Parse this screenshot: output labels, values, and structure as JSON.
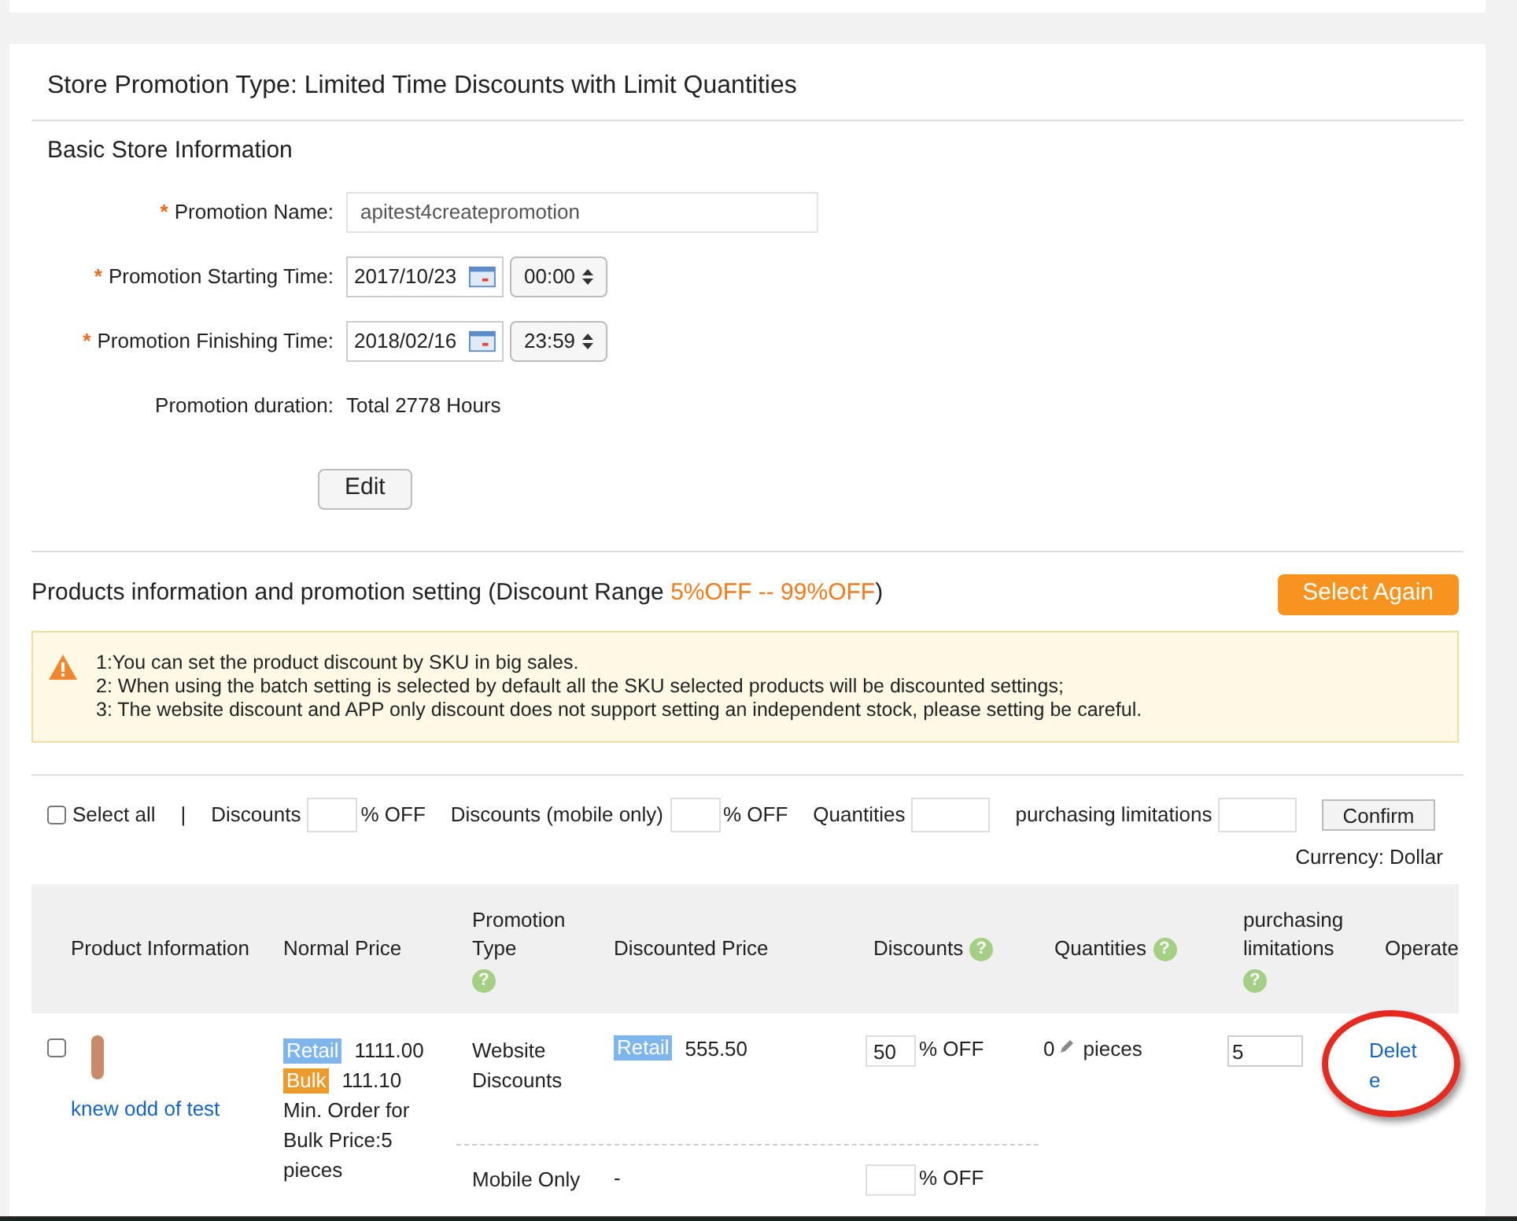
{
  "page_title": "Store Promotion Type: Limited Time Discounts with Limit Quantities",
  "basic_info": {
    "heading": "Basic Store Information",
    "fields": [
      {
        "kind": "text",
        "label": "Promotion Name:",
        "required": "*",
        "value": "apitest4createpromotion"
      },
      {
        "kind": "datetime",
        "label": "Promotion Starting Time:",
        "required": "*",
        "date": "2017/10/23",
        "time": "00:00"
      },
      {
        "kind": "datetime",
        "label": "Promotion Finishing Time:",
        "required": "*",
        "date": "2018/02/16",
        "time": "23:59"
      },
      {
        "kind": "readonly",
        "label": "Promotion duration:",
        "value": "Total 2778 Hours"
      }
    ],
    "edit_button": "Edit"
  },
  "products": {
    "heading": "Products information and promotion setting (Discount Range ",
    "range": "5%OFF -- 99%OFF",
    "heading_end": ")",
    "select_again": "Select Again",
    "notices": [
      "1:You can set the product discount by SKU in big sales.",
      "2: When using the batch setting is selected by default all the SKU selected products will be discounted settings;",
      "3: The website discount and APP only discount does not support setting an independent stock, please setting be careful."
    ],
    "batch": {
      "select_all": {
        "label": "Select all",
        "checked": false
      },
      "separator": "|",
      "fields": [
        {
          "label": "Discounts",
          "unit": "% OFF"
        },
        {
          "label": "Discounts (mobile only)",
          "unit": "% OFF"
        },
        {
          "label": "Quantities"
        },
        {
          "label": "purchasing limitations"
        }
      ],
      "confirm": "Confirm",
      "currency": "Currency: Dollar"
    },
    "table": {
      "columns": [
        {
          "label": "Product Information"
        },
        {
          "label": "Normal Price"
        },
        {
          "label": "Promotion Type",
          "help": "?"
        },
        {
          "label": "Discounted Price"
        },
        {
          "label": "Discounts",
          "help": "?"
        },
        {
          "label": "Quantities",
          "help": "?"
        },
        {
          "label": "purchasing limitations",
          "help": "?"
        },
        {
          "label": "Operate"
        }
      ],
      "rows": [
        {
          "checked": false,
          "product_name": "knew odd of test",
          "prices": [
            {
              "tag": "Retail",
              "color": "#7eb6ec",
              "value": "1111.00"
            },
            {
              "tag": "Bulk",
              "color": "#eb9a2c",
              "value": "111.10"
            }
          ],
          "min_order": "Min. Order for Bulk Price:5 pieces",
          "promotions": [
            {
              "type": "Website Discounts",
              "tag": "Retail",
              "color": "#7eb6ec",
              "price": "555.50",
              "discount": "50",
              "unit": "% OFF"
            },
            {
              "type": "Mobile Only",
              "price": "-",
              "unit": "% OFF"
            }
          ],
          "quantity": "0",
          "quantity_unit": "pieces",
          "limit": "5",
          "operate": "Delete",
          "highlighted": true
        }
      ]
    }
  }
}
